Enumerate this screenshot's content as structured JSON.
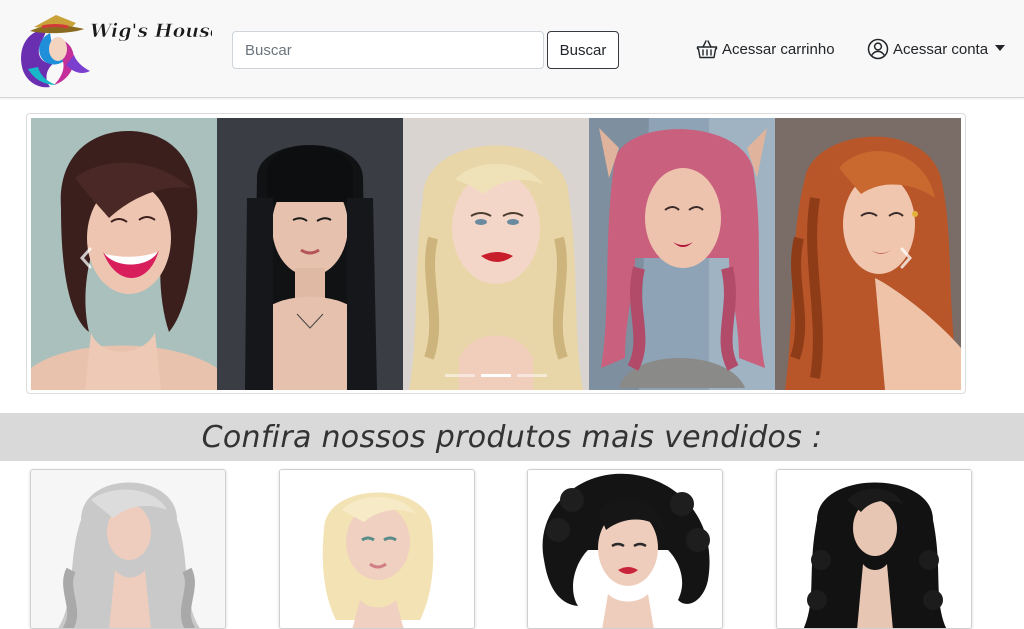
{
  "header": {
    "logo_text": "Wig's House",
    "search": {
      "placeholder": "Buscar",
      "value": ""
    },
    "search_button_label": "Buscar",
    "cart_label": "Acessar carrinho",
    "account_label": "Acessar conta"
  },
  "carousel": {
    "slides": [
      {
        "hair": "dark brown bob",
        "bg": "#a9c0bd"
      },
      {
        "hair": "black straight with bangs",
        "bg": "#3a3d44"
      },
      {
        "hair": "platinum blonde waves",
        "bg": "#d9d4cf"
      },
      {
        "hair": "pink waves",
        "bg": "#8ea3b5"
      },
      {
        "hair": "copper red waves",
        "bg": "#7a6c66"
      }
    ],
    "indicator_count": 3,
    "active_indicator": 1,
    "prev_icon": "chevron-left-icon",
    "next_icon": "chevron-right-icon"
  },
  "section": {
    "title": "Confira nossos produtos mais vendidos :"
  },
  "products": [
    {
      "hair": "silver long waves"
    },
    {
      "hair": "light blonde bob"
    },
    {
      "hair": "black curly short"
    },
    {
      "hair": "black long curly"
    }
  ],
  "colors": {
    "header_bg": "#f8f8f8",
    "section_band": "#d9d9d9",
    "button_border": "#343a40"
  }
}
